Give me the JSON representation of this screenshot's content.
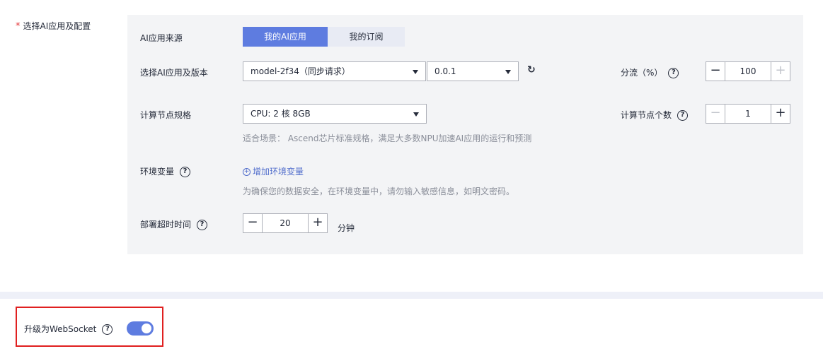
{
  "section": {
    "required_mark": "*",
    "title": "选择AI应用及配置"
  },
  "source": {
    "label": "AI应用来源",
    "options": [
      "我的AI应用",
      "我的订阅"
    ],
    "selected": "我的AI应用"
  },
  "model": {
    "label": "选择AI应用及版本",
    "app_value": "model-2f34（同步请求）",
    "version_value": "0.0.1"
  },
  "split": {
    "label": "分流（%）",
    "value": "100",
    "minus": "−",
    "plus": "+"
  },
  "spec": {
    "label": "计算节点规格",
    "value": "CPU: 2 核 8GB",
    "hint": "适合场景： Ascend芯片标准规格，满足大多数NPU加速AI应用的运行和预测"
  },
  "nodes": {
    "label": "计算节点个数",
    "value": "1",
    "minus": "−",
    "plus": "+"
  },
  "env": {
    "label": "环境变量",
    "add_link": "增加环境变量",
    "hint": "为确保您的数据安全，在环境变量中，请勿输入敏感信息，如明文密码。"
  },
  "timeout": {
    "label": "部署超时时间",
    "value": "20",
    "unit": "分钟",
    "minus": "−",
    "plus": "+"
  },
  "websocket": {
    "label": "升级为WebSocket",
    "enabled": true
  },
  "colors": {
    "accent": "#5e7ce0",
    "highlight_border": "#e02020",
    "panel_bg": "#f3f4f6"
  },
  "icons": {
    "help": "question-circle-icon",
    "refresh": "refresh-icon",
    "add": "plus-circle-icon",
    "caret": "chevron-down-icon"
  }
}
